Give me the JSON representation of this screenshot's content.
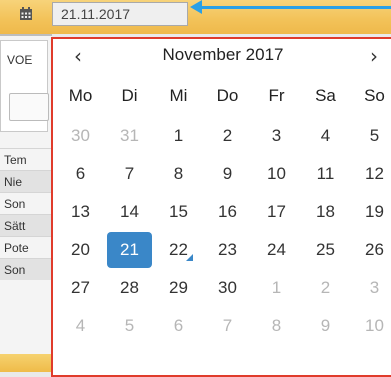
{
  "background": {
    "section_label": "VOE",
    "rows": [
      "Tem",
      "Nie",
      "Son",
      "Sätt",
      "Pote",
      "Son"
    ]
  },
  "date_field": {
    "icon": "calendar-icon",
    "value": "21.11.2017"
  },
  "colors": {
    "accent": "#3a87c8",
    "highlight_border": "#e03b2b",
    "arrow": "#2aa0e6"
  },
  "calendar": {
    "month_title": "November 2017",
    "prev_label": "‹",
    "next_label": "›",
    "weekdays": [
      "Mo",
      "Di",
      "Mi",
      "Do",
      "Fr",
      "Sa",
      "So"
    ],
    "weeks": [
      [
        {
          "d": "30",
          "m": true
        },
        {
          "d": "31",
          "m": true
        },
        {
          "d": "1"
        },
        {
          "d": "2"
        },
        {
          "d": "3"
        },
        {
          "d": "4"
        },
        {
          "d": "5"
        }
      ],
      [
        {
          "d": "6"
        },
        {
          "d": "7"
        },
        {
          "d": "8"
        },
        {
          "d": "9"
        },
        {
          "d": "10"
        },
        {
          "d": "11"
        },
        {
          "d": "12"
        }
      ],
      [
        {
          "d": "13"
        },
        {
          "d": "14"
        },
        {
          "d": "15"
        },
        {
          "d": "16"
        },
        {
          "d": "17"
        },
        {
          "d": "18"
        },
        {
          "d": "19"
        }
      ],
      [
        {
          "d": "20"
        },
        {
          "d": "21",
          "sel": true
        },
        {
          "d": "22",
          "today": true
        },
        {
          "d": "23"
        },
        {
          "d": "24"
        },
        {
          "d": "25"
        },
        {
          "d": "26"
        }
      ],
      [
        {
          "d": "27"
        },
        {
          "d": "28"
        },
        {
          "d": "29"
        },
        {
          "d": "30"
        },
        {
          "d": "1",
          "m": true
        },
        {
          "d": "2",
          "m": true
        },
        {
          "d": "3",
          "m": true
        }
      ],
      [
        {
          "d": "4",
          "m": true
        },
        {
          "d": "5",
          "m": true
        },
        {
          "d": "6",
          "m": true
        },
        {
          "d": "7",
          "m": true
        },
        {
          "d": "8",
          "m": true
        },
        {
          "d": "9",
          "m": true
        },
        {
          "d": "10",
          "m": true
        }
      ]
    ]
  }
}
